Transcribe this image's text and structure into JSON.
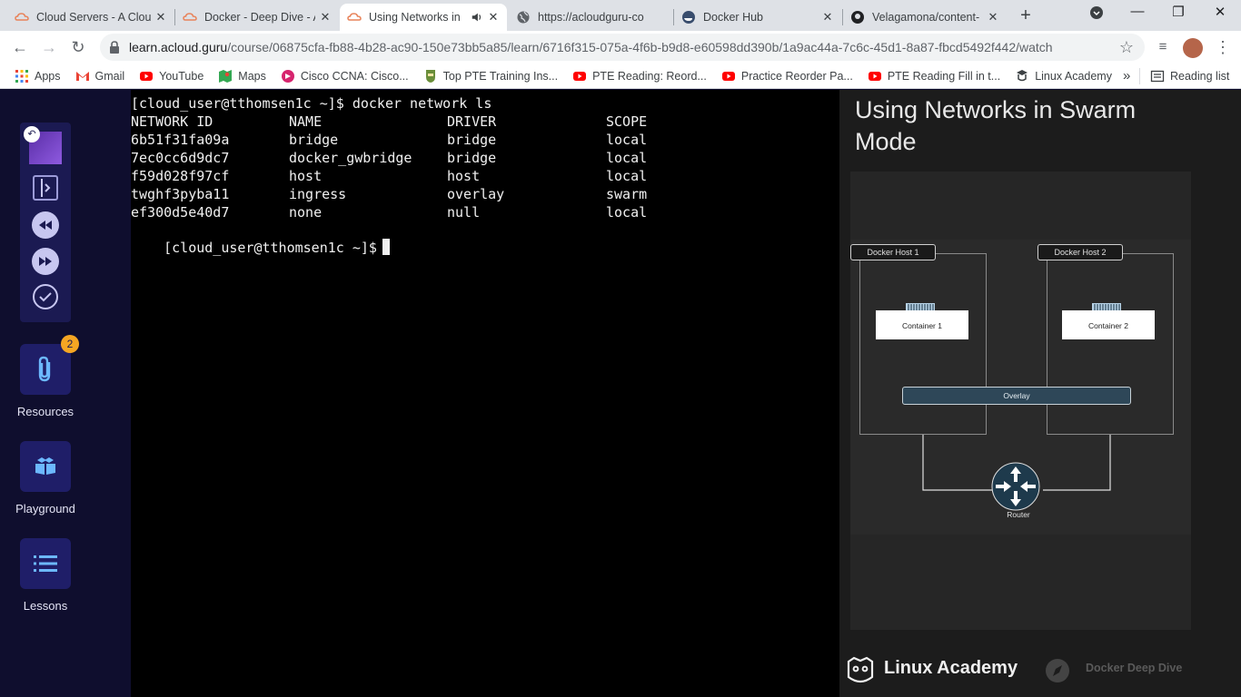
{
  "browser": {
    "tabs": [
      {
        "title": "Cloud Servers - A Clou",
        "icon": "acloudguru-icon"
      },
      {
        "title": "Docker - Deep Dive - A",
        "icon": "acloudguru-icon"
      },
      {
        "title": "Using Networks in",
        "icon": "acloudguru-icon",
        "active": true,
        "audio": true
      },
      {
        "title": "https://acloudguru-co",
        "icon": "globe-icon"
      },
      {
        "title": "Docker Hub",
        "icon": "docker-icon"
      },
      {
        "title": "Velagamona/content-",
        "icon": "github-icon"
      }
    ],
    "url_host": "learn.acloud.guru",
    "url_path": "/course/06875cfa-fb88-4b28-ac90-150e73bb5a85/learn/6716f315-075a-4f6b-b9d8-e60598dd390b/1a9ac44a-7c6c-45d1-8a87-fbcd5492f442/watch",
    "bookmarks": [
      {
        "label": "Apps",
        "icon": "apps-grid-icon"
      },
      {
        "label": "Gmail",
        "icon": "gmail-icon"
      },
      {
        "label": "YouTube",
        "icon": "youtube-icon"
      },
      {
        "label": "Maps",
        "icon": "maps-icon"
      },
      {
        "label": "Cisco CCNA: Cisco...",
        "icon": "cisco-icon"
      },
      {
        "label": "Top PTE Training Ins...",
        "icon": "pte-icon"
      },
      {
        "label": "PTE Reading: Reord...",
        "icon": "youtube-icon"
      },
      {
        "label": "Practice Reorder Pa...",
        "icon": "youtube-icon"
      },
      {
        "label": "PTE Reading Fill in t...",
        "icon": "youtube-icon"
      },
      {
        "label": "Linux Academy",
        "icon": "linux-academy-icon"
      }
    ],
    "bookmarks_more": "»",
    "reading_list": "Reading list"
  },
  "sidebar": {
    "resources_badge": "2",
    "resources_label": "Resources",
    "playground_label": "Playground",
    "lessons_label": "Lessons"
  },
  "terminal": {
    "command_line": "[cloud_user@tthomsen1c ~]$ docker network ls",
    "headers": [
      "NETWORK ID",
      "NAME",
      "DRIVER",
      "SCOPE"
    ],
    "rows": [
      [
        "6b51f31fa09a",
        "bridge",
        "bridge",
        "local"
      ],
      [
        "7ec0cc6d9dc7",
        "docker_gwbridge",
        "bridge",
        "local"
      ],
      [
        "f59d028f97cf",
        "host",
        "host",
        "local"
      ],
      [
        "twghf3pyba11",
        "ingress",
        "overlay",
        "swarm"
      ],
      [
        "ef300d5e40d7",
        "none",
        "null",
        "local"
      ]
    ],
    "prompt": "[cloud_user@tthomsen1c ~]$"
  },
  "slide": {
    "title": "Using Networks in Swarm Mode",
    "host1_label": "Docker Host 1",
    "host2_label": "Docker Host 2",
    "container1_label": "Container 1",
    "container2_label": "Container 2",
    "overlay_label": "Overlay",
    "router_label": "Router",
    "brand": "Linux Academy",
    "course_name": "Docker Deep Dive"
  },
  "colors": {
    "sidebar_bg": "#0f0e2e",
    "sidebar_button": "#1f1e68",
    "badge": "#f5a623",
    "overlay": "#2e4758"
  }
}
